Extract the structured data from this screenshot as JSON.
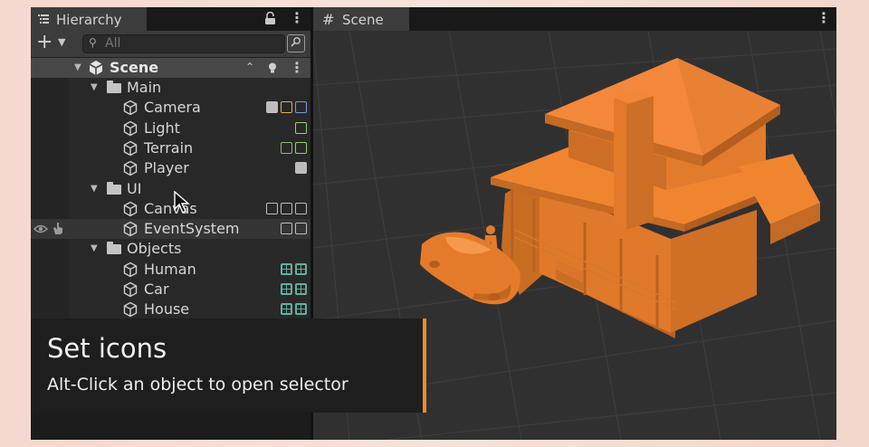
{
  "hierarchy": {
    "tab_title": "Hierarchy",
    "search_placeholder": "All",
    "scene": {
      "name": "Scene"
    },
    "items": [
      {
        "label": "Main",
        "kind": "folder",
        "depth": 1,
        "icon": "folder-icon"
      },
      {
        "label": "Camera",
        "kind": "object",
        "depth": 2,
        "icon": "cube-icon",
        "component_icons": [
          "script-icon",
          "audio-listener-icon",
          "camera-icon"
        ]
      },
      {
        "label": "Light",
        "kind": "object",
        "depth": 2,
        "icon": "cube-icon",
        "component_icons": [
          "light-icon"
        ]
      },
      {
        "label": "Terrain",
        "kind": "object",
        "depth": 2,
        "icon": "cube-icon",
        "component_icons": [
          "terrain-icon",
          "terrain-collider-icon"
        ]
      },
      {
        "label": "Player",
        "kind": "object",
        "depth": 2,
        "icon": "cube-icon",
        "component_icons": [
          "script-icon"
        ]
      },
      {
        "label": "UI",
        "kind": "folder",
        "depth": 1,
        "icon": "folder-icon"
      },
      {
        "label": "Canvas",
        "kind": "object",
        "depth": 2,
        "icon": "cube-icon",
        "component_icons": [
          "rect-transform-icon",
          "canvas-icon",
          "canvas-scaler-icon"
        ]
      },
      {
        "label": "EventSystem",
        "kind": "object",
        "depth": 2,
        "icon": "cube-icon",
        "component_icons": [
          "event-system-icon",
          "input-module-icon"
        ]
      },
      {
        "label": "Objects",
        "kind": "folder",
        "depth": 1,
        "icon": "folder-icon"
      },
      {
        "label": "Human",
        "kind": "object",
        "depth": 2,
        "icon": "cube-icon",
        "component_icons": [
          "mesh-icon",
          "grid-icon"
        ]
      },
      {
        "label": "Car",
        "kind": "object",
        "depth": 2,
        "icon": "cube-icon",
        "component_icons": [
          "mesh-icon",
          "grid-icon"
        ]
      },
      {
        "label": "House",
        "kind": "object",
        "depth": 2,
        "icon": "cube-icon",
        "component_icons": [
          "mesh-icon",
          "grid-icon"
        ]
      }
    ]
  },
  "scene_view": {
    "tab_title": "Scene"
  },
  "caption": {
    "title": "Set icons",
    "subtitle": "Alt-Click an object to open selector"
  },
  "colors": {
    "accent": "#f08a2c",
    "model_orange": "#f2852d",
    "panel_bg": "#282828"
  }
}
